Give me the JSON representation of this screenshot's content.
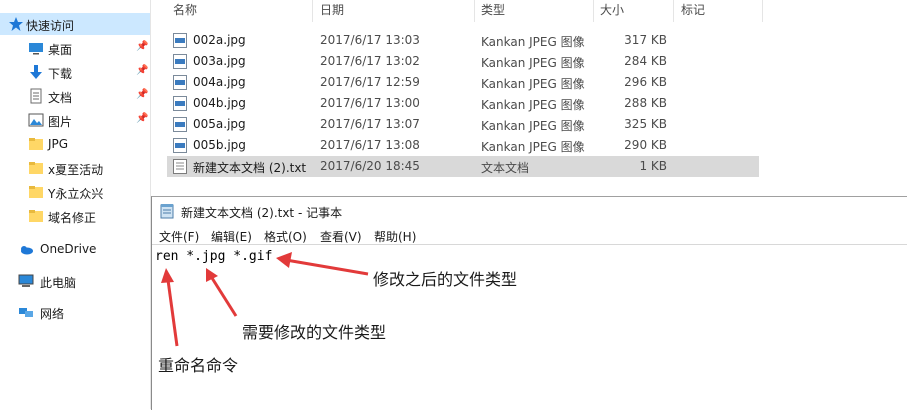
{
  "sidebar": {
    "items": [
      {
        "label": "快速访问",
        "icon": "star-icon",
        "selected": true
      },
      {
        "label": "桌面",
        "icon": "desktop-icon",
        "pinned": true
      },
      {
        "label": "下载",
        "icon": "download-icon",
        "pinned": true
      },
      {
        "label": "文档",
        "icon": "document-icon",
        "pinned": true
      },
      {
        "label": "图片",
        "icon": "picture-icon",
        "pinned": true
      },
      {
        "label": "JPG",
        "icon": "folder-icon"
      },
      {
        "label": "x夏至活动",
        "icon": "folder-icon"
      },
      {
        "label": "Y永立众兴",
        "icon": "folder-icon"
      },
      {
        "label": "域名修正",
        "icon": "folder-icon"
      },
      {
        "label": "OneDrive",
        "icon": "cloud-icon"
      },
      {
        "label": "此电脑",
        "icon": "computer-icon"
      },
      {
        "label": "网络",
        "icon": "network-icon"
      }
    ]
  },
  "columns": {
    "name": "名称",
    "date": "日期",
    "type": "类型",
    "size": "大小",
    "tags": "标记"
  },
  "files": [
    {
      "name": "002a.jpg",
      "date": "2017/6/17 13:03",
      "type": "Kankan JPEG 图像",
      "size": "317 KB"
    },
    {
      "name": "003a.jpg",
      "date": "2017/6/17 13:02",
      "type": "Kankan JPEG 图像",
      "size": "284 KB"
    },
    {
      "name": "004a.jpg",
      "date": "2017/6/17 12:59",
      "type": "Kankan JPEG 图像",
      "size": "296 KB"
    },
    {
      "name": "004b.jpg",
      "date": "2017/6/17 13:00",
      "type": "Kankan JPEG 图像",
      "size": "288 KB"
    },
    {
      "name": "005a.jpg",
      "date": "2017/6/17 13:07",
      "type": "Kankan JPEG 图像",
      "size": "325 KB"
    },
    {
      "name": "005b.jpg",
      "date": "2017/6/17 13:08",
      "type": "Kankan JPEG 图像",
      "size": "290 KB"
    },
    {
      "name": "新建文本文档 (2).txt",
      "date": "2017/6/20 18:45",
      "type": "文本文档",
      "size": "1 KB"
    }
  ],
  "notepad": {
    "title": "新建文本文档 (2).txt - 记事本",
    "menu": [
      "文件(F)",
      "编辑(E)",
      "格式(O)",
      "查看(V)",
      "帮助(H)"
    ],
    "content": "ren *.jpg *.gif"
  },
  "annotations": {
    "after_type": "修改之后的文件类型",
    "before_type": "需要修改的文件类型",
    "rename_cmd": "重命名命令",
    "color": "#e23a3a"
  }
}
